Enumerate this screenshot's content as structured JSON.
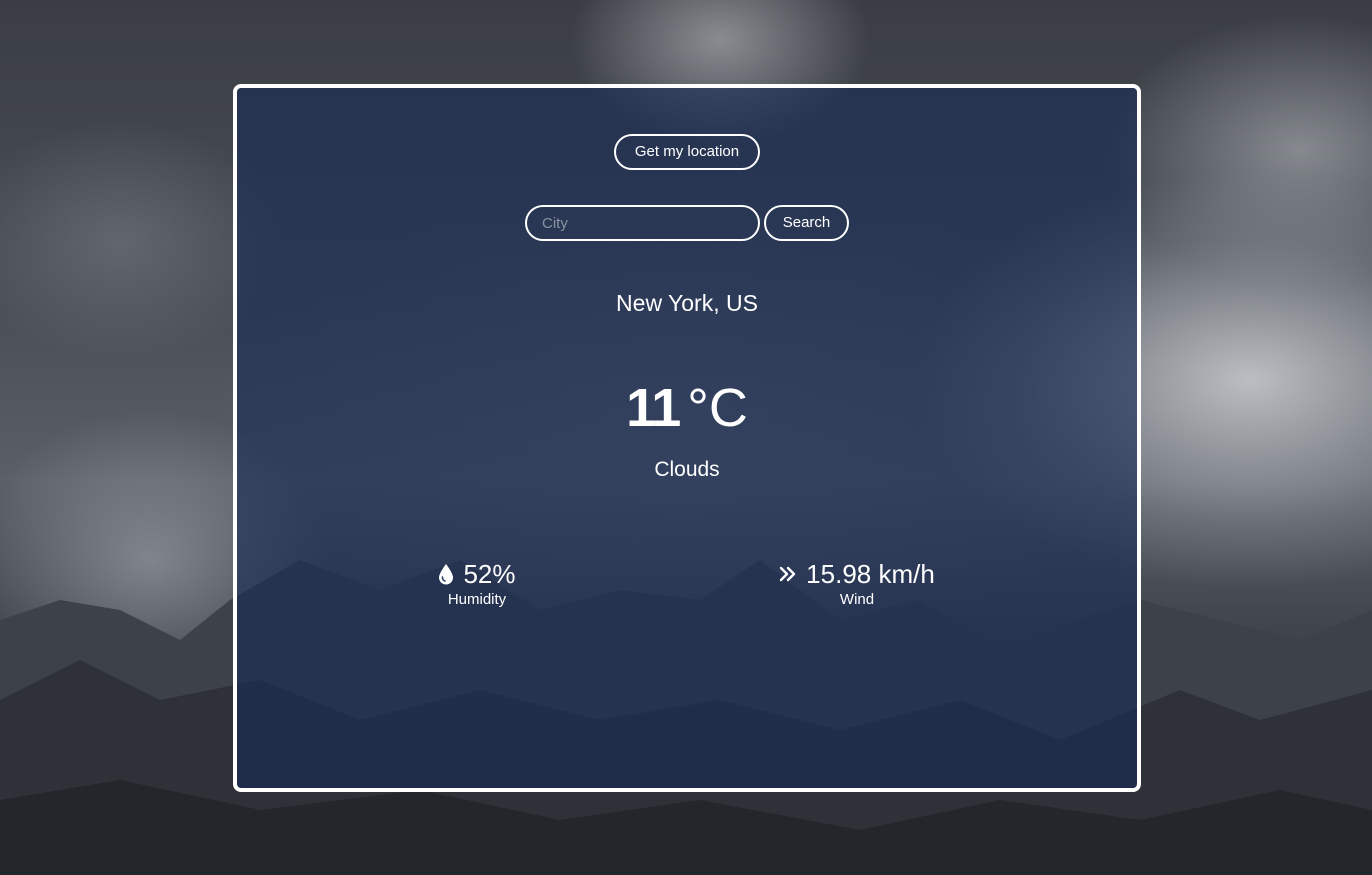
{
  "location_button": {
    "label": "Get my location"
  },
  "search": {
    "placeholder": "City",
    "value": "",
    "button_label": "Search"
  },
  "weather": {
    "location": "New York, US",
    "temperature": "11",
    "unit": "°C",
    "condition": "Clouds"
  },
  "stats": {
    "humidity": {
      "value": "52%",
      "label": "Humidity",
      "icon": "droplet-icon"
    },
    "wind": {
      "value": "15.98 km/h",
      "label": "Wind",
      "icon": "double-chevron-right-icon"
    }
  },
  "colors": {
    "card_overlay": "#172a55",
    "border": "#ffffff",
    "text": "#ffffff"
  }
}
